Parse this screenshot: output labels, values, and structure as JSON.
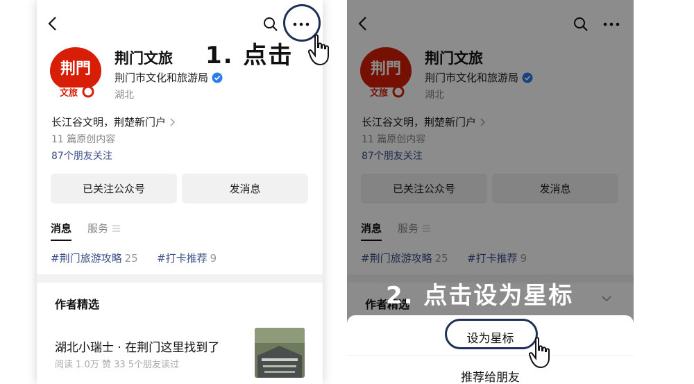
{
  "account": {
    "name": "荆门文旅",
    "org": "荆门市文化和旅游局",
    "region": "湖北",
    "slogan": "长江谷文明，荆楚新门户",
    "articles_count": "11 篇原创内容",
    "friends_following": "87个朋友关注",
    "logo": {
      "top_text": "荆門",
      "bottom_text": "文旅"
    }
  },
  "buttons": {
    "followed": "已关注公众号",
    "send_message": "发消息"
  },
  "tabs": {
    "messages": "消息",
    "services": "服务"
  },
  "tags": [
    {
      "label": "#荆门旅游攻略",
      "count": "25"
    },
    {
      "label": "#打卡推荐",
      "count": "9"
    }
  ],
  "featured": {
    "section_title": "作者精选",
    "article_title": "湖北小瑞士 · 在荆门这里找到了",
    "article_meta": "阅读 1.0万  赞 33  5个朋友读过"
  },
  "sheet": {
    "set_star": "设为星标",
    "recommend": "推荐给朋友"
  },
  "steps": {
    "step1": "1. 点击",
    "step2": "2. 点击设为星标"
  },
  "icons": [
    "back-arrow-icon",
    "search-icon",
    "more-icon",
    "verified-icon",
    "chevron-right-icon",
    "menu-icon",
    "chevron-down-icon",
    "hand-cursor-icon"
  ],
  "colors": {
    "link": "#3b4f8a",
    "verified": "#2b7de9",
    "logo_red": "#d81e06",
    "ring": "#1f2f57"
  }
}
